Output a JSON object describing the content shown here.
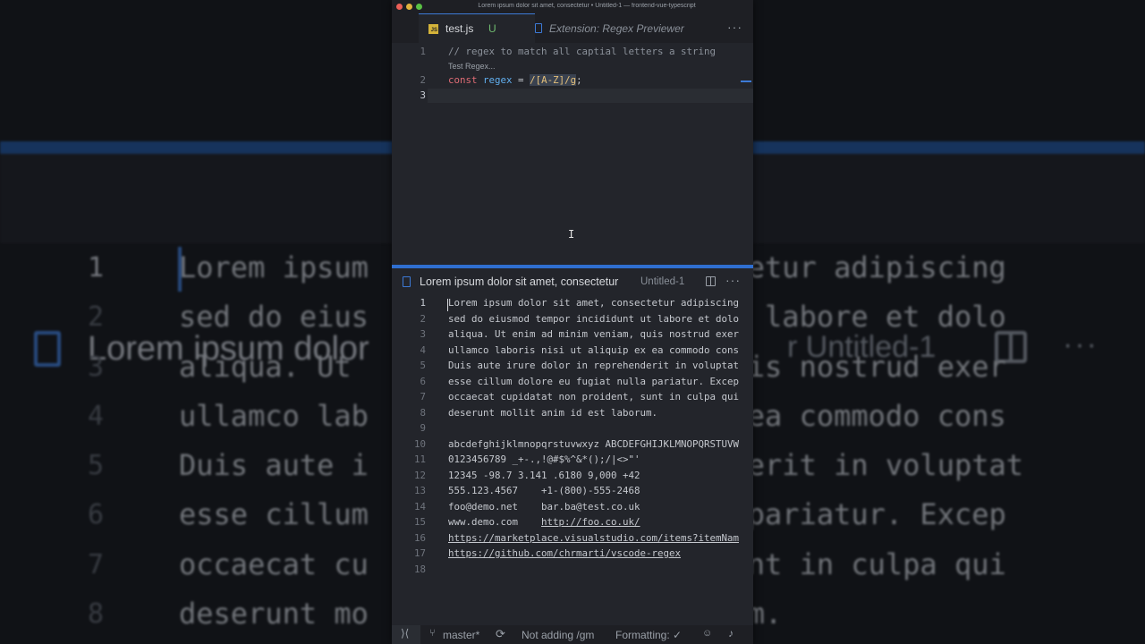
{
  "window": {
    "title": "Lorem ipsum dolor sit amet, consectetur • Untitled-1 — frontend-vue-typescript"
  },
  "tabs": [
    {
      "label": "test.js",
      "badge": "U",
      "icon": "js-file-icon"
    },
    {
      "label": "Extension: Regex Previewer",
      "icon": "file-icon"
    }
  ],
  "test_js": {
    "lines": [
      "1",
      "2",
      "3"
    ],
    "comment": "// regex to match all captial letters a string",
    "codelens": "Test Regex...",
    "line2": {
      "kw": "const",
      "id": "regex",
      "eq": " = ",
      "regex": "/[A-Z]/g",
      "semi": ";"
    }
  },
  "preview": {
    "title": "Lorem ipsum dolor sit amet, consectetur",
    "subtitle": "Untitled-1",
    "lines": [
      {
        "n": "1",
        "t": "Lorem ipsum dolor sit amet, consectetur adipiscing"
      },
      {
        "n": "2",
        "t": "sed do eiusmod tempor incididunt ut labore et dolo"
      },
      {
        "n": "3",
        "t": "aliqua. Ut enim ad minim veniam, quis nostrud exer"
      },
      {
        "n": "4",
        "t": "ullamco laboris nisi ut aliquip ex ea commodo cons"
      },
      {
        "n": "5",
        "t": "Duis aute irure dolor in reprehenderit in voluptat"
      },
      {
        "n": "6",
        "t": "esse cillum dolore eu fugiat nulla pariatur. Excep"
      },
      {
        "n": "7",
        "t": "occaecat cupidatat non proident, sunt in culpa qui"
      },
      {
        "n": "8",
        "t": "deserunt mollit anim id est laborum."
      },
      {
        "n": "9",
        "t": ""
      },
      {
        "n": "10",
        "t": "abcdefghijklmnopqrstuvwxyz ABCDEFGHIJKLMNOPQRSTUVW"
      },
      {
        "n": "11",
        "t": "0123456789 _+-.,!@#$%^&*();/|<>\"'"
      },
      {
        "n": "12",
        "t": "12345 -98.7 3.141 .6180 9,000 +42"
      },
      {
        "n": "13",
        "t": "555.123.4567    +1-(800)-555-2468"
      },
      {
        "n": "14",
        "t": "foo@demo.net    bar.ba@test.co.uk"
      },
      {
        "n": "15",
        "a": "www.demo.com    ",
        "u": "http://foo.co.uk/"
      },
      {
        "n": "16",
        "u": "https://marketplace.visualstudio.com/items?itemNam"
      },
      {
        "n": "17",
        "u": "https://github.com/chrmarti/vscode-regex"
      },
      {
        "n": "18",
        "t": ""
      }
    ]
  },
  "background_mirror": {
    "title": "Lorem ipsum dolor",
    "untitled": "r  Untitled-1",
    "lines": [
      {
        "n": "1",
        "t": "Lorem ipsum                 nsectetur adipiscing"
      },
      {
        "n": "2",
        "t": "sed do eius                 nt ut labore et dolo"
      },
      {
        "n": "3",
        "t": "aliqua. Ut                  m, quis nostrud exer"
      },
      {
        "n": "4",
        "t": "ullamco lab                 p ex ea commodo cons"
      },
      {
        "n": "5",
        "t": "Duis aute i                 ehenderit in voluptat"
      },
      {
        "n": "6",
        "t": "esse cillum                 ulla pariatur. Excep"
      },
      {
        "n": "7",
        "t": "occaecat cu                 t, sunt in culpa qui"
      },
      {
        "n": "8",
        "t": "deserunt mo                 aborum."
      }
    ]
  },
  "statusbar": {
    "branch": "master*",
    "regex_status": "Not adding /gm",
    "formatting": "Formatting: ✓"
  },
  "colors": {
    "accent": "#3d7ad6",
    "keyword": "#e06c75",
    "identifier": "#61afef",
    "regex": "#e5c07b"
  }
}
